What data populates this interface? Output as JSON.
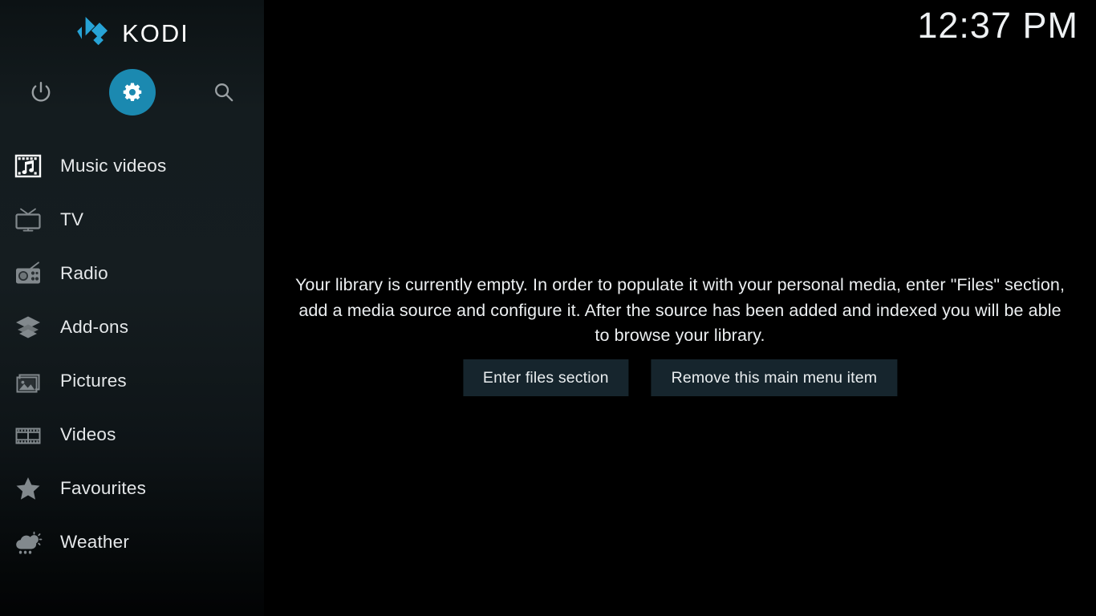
{
  "app": {
    "name": "KODI",
    "logo_icon": "kodi-logo-icon",
    "accent_color": "#1b89b0",
    "sidebar_bg": "#141c1f",
    "button_bg": "#16252d"
  },
  "header": {
    "clock": "12:37 PM"
  },
  "top_actions": [
    {
      "name": "power",
      "icon": "power-icon",
      "label": "Power",
      "selected": false
    },
    {
      "name": "settings",
      "icon": "gear-icon",
      "label": "Settings",
      "selected": true
    },
    {
      "name": "search",
      "icon": "search-icon",
      "label": "Search",
      "selected": false
    }
  ],
  "sidebar": {
    "items": [
      {
        "label": "Music videos",
        "icon": "music-videos-icon",
        "selected": true
      },
      {
        "label": "TV",
        "icon": "tv-icon",
        "selected": false
      },
      {
        "label": "Radio",
        "icon": "radio-icon",
        "selected": false
      },
      {
        "label": "Add-ons",
        "icon": "addons-box-icon",
        "selected": false
      },
      {
        "label": "Pictures",
        "icon": "pictures-icon",
        "selected": false
      },
      {
        "label": "Videos",
        "icon": "videos-filmstrip-icon",
        "selected": false
      },
      {
        "label": "Favourites",
        "icon": "star-icon",
        "selected": false
      },
      {
        "label": "Weather",
        "icon": "weather-cloud-sun-rain-icon",
        "selected": false
      }
    ]
  },
  "main": {
    "empty_message": "Your library is currently empty. In order to populate it with your personal media, enter \"Files\" section, add a media source and configure it. After the source has been added and indexed you will be able to browse your library.",
    "buttons": [
      {
        "label": "Enter files section",
        "name": "enter-files-section-button"
      },
      {
        "label": "Remove this main menu item",
        "name": "remove-main-menu-item-button"
      }
    ]
  }
}
